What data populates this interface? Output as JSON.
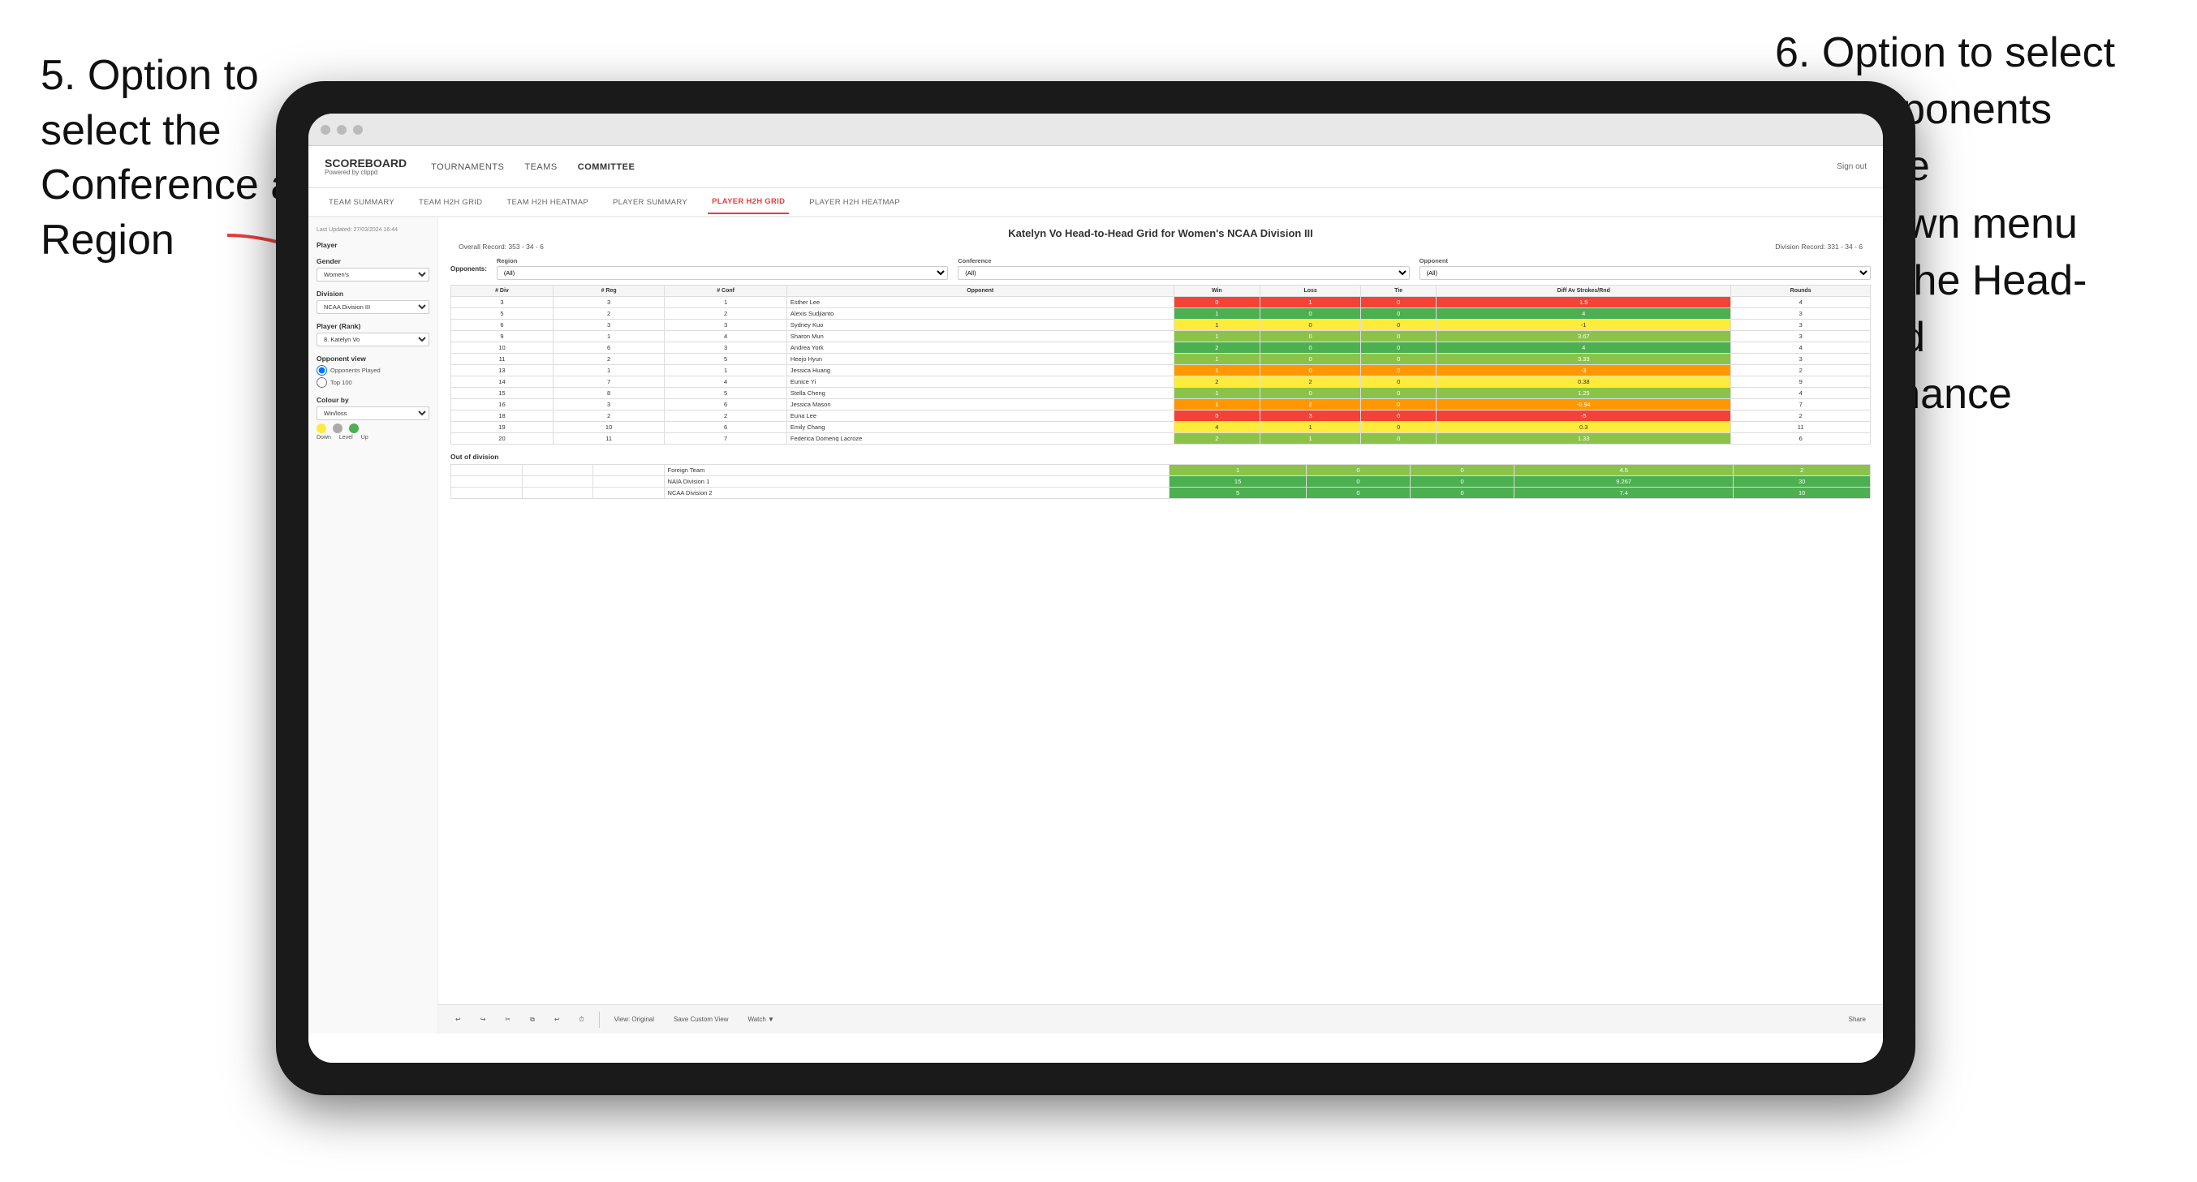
{
  "annotations": {
    "left": {
      "line1": "5. Option to",
      "line2": "select the",
      "line3": "Conference and",
      "line4": "Region"
    },
    "right": {
      "line1": "6. Option to select",
      "line2": "the Opponents",
      "line3": "from the",
      "line4": "dropdown menu",
      "line5": "to see the Head-",
      "line6": "to-Head",
      "line7": "performance"
    }
  },
  "nav": {
    "logo": "SCOREBOARD",
    "logo_sub": "Powered by clippd",
    "items": [
      "TOURNAMENTS",
      "TEAMS",
      "COMMITTEE"
    ],
    "active_item": "COMMITTEE",
    "right": [
      "Sign out"
    ]
  },
  "sub_nav": {
    "items": [
      "TEAM SUMMARY",
      "TEAM H2H GRID",
      "TEAM H2H HEATMAP",
      "PLAYER SUMMARY",
      "PLAYER H2H GRID",
      "PLAYER H2H HEATMAP"
    ],
    "active_item": "PLAYER H2H GRID"
  },
  "sidebar": {
    "updated": "Last Updated: 27/03/2024 16:44",
    "player_label": "Player",
    "gender_label": "Gender",
    "gender_value": "Women's",
    "division_label": "Division",
    "division_value": "NCAA Division III",
    "player_rank_label": "Player (Rank)",
    "player_rank_value": "8. Katelyn Vo",
    "opponent_view_label": "Opponent view",
    "opponent_options": [
      "Opponents Played",
      "Top 100"
    ],
    "opponent_selected": "Opponents Played",
    "colour_by_label": "Colour by",
    "colour_by_value": "Win/loss",
    "legend_labels": [
      "Down",
      "Level",
      "Up"
    ]
  },
  "main": {
    "title": "Katelyn Vo Head-to-Head Grid for Women's NCAA Division III",
    "overall_record": "Overall Record: 353 - 34 - 6",
    "division_record": "Division Record: 331 - 34 - 6",
    "region_label": "Region",
    "conference_label": "Conference",
    "opponent_label": "Opponent",
    "opponents_label": "Opponents:",
    "region_value": "(All)",
    "conference_value": "(All)",
    "opponent_value": "(All)",
    "table_headers": [
      "# Div",
      "# Reg",
      "# Conf",
      "Opponent",
      "Win",
      "Loss",
      "Tie",
      "Diff Av Strokes/Rnd",
      "Rounds"
    ],
    "rows": [
      {
        "div": 3,
        "reg": 3,
        "conf": 1,
        "opponent": "Esther Lee",
        "win": 0,
        "loss": 1,
        "tie": 0,
        "diff": 1.5,
        "rounds": 4,
        "color": "red"
      },
      {
        "div": 5,
        "reg": 2,
        "conf": 2,
        "opponent": "Alexis Sudjianto",
        "win": 1,
        "loss": 0,
        "tie": 0,
        "diff": 4.0,
        "rounds": 3,
        "color": "green-dark"
      },
      {
        "div": 6,
        "reg": 3,
        "conf": 3,
        "opponent": "Sydney Kuo",
        "win": 1,
        "loss": 0,
        "tie": 0,
        "diff": -1.0,
        "rounds": 3,
        "color": "yellow"
      },
      {
        "div": 9,
        "reg": 1,
        "conf": 4,
        "opponent": "Sharon Mun",
        "win": 1,
        "loss": 0,
        "tie": 0,
        "diff": 3.67,
        "rounds": 3,
        "color": "green-light"
      },
      {
        "div": 10,
        "reg": 6,
        "conf": 3,
        "opponent": "Andrea York",
        "win": 2,
        "loss": 0,
        "tie": 0,
        "diff": 4.0,
        "rounds": 4,
        "color": "green-dark"
      },
      {
        "div": 11,
        "reg": 2,
        "conf": 5,
        "opponent": "Heejo Hyun",
        "win": 1,
        "loss": 0,
        "tie": 0,
        "diff": 3.33,
        "rounds": 3,
        "color": "green-light"
      },
      {
        "div": 13,
        "reg": 1,
        "conf": 1,
        "opponent": "Jessica Huang",
        "win": 1,
        "loss": 0,
        "tie": 0,
        "diff": -3.0,
        "rounds": 2,
        "color": "orange"
      },
      {
        "div": 14,
        "reg": 7,
        "conf": 4,
        "opponent": "Eunice Yi",
        "win": 2,
        "loss": 2,
        "tie": 0,
        "diff": 0.38,
        "rounds": 9,
        "color": "yellow"
      },
      {
        "div": 15,
        "reg": 8,
        "conf": 5,
        "opponent": "Stella Cheng",
        "win": 1,
        "loss": 0,
        "tie": 0,
        "diff": 1.25,
        "rounds": 4,
        "color": "green-light"
      },
      {
        "div": 16,
        "reg": 3,
        "conf": 6,
        "opponent": "Jessica Mason",
        "win": 1,
        "loss": 2,
        "tie": 0,
        "diff": -0.94,
        "rounds": 7,
        "color": "orange"
      },
      {
        "div": 18,
        "reg": 2,
        "conf": 2,
        "opponent": "Euna Lee",
        "win": 0,
        "loss": 3,
        "tie": 0,
        "diff": -5.0,
        "rounds": 2,
        "color": "red"
      },
      {
        "div": 19,
        "reg": 10,
        "conf": 6,
        "opponent": "Emily Chang",
        "win": 4,
        "loss": 1,
        "tie": 0,
        "diff": 0.3,
        "rounds": 11,
        "color": "yellow"
      },
      {
        "div": 20,
        "reg": 11,
        "conf": 7,
        "opponent": "Federica Domenq Lacroze",
        "win": 2,
        "loss": 1,
        "tie": 0,
        "diff": 1.33,
        "rounds": 6,
        "color": "green-light"
      }
    ],
    "out_of_division_label": "Out of division",
    "out_rows": [
      {
        "opponent": "Foreign Team",
        "win": 1,
        "loss": 0,
        "tie": 0,
        "diff": 4.5,
        "rounds": 2,
        "color": "green-light"
      },
      {
        "opponent": "NAIA Division 1",
        "win": 15,
        "loss": 0,
        "tie": 0,
        "diff": 9.267,
        "rounds": 30,
        "color": "green-dark"
      },
      {
        "opponent": "NCAA Division 2",
        "win": 5,
        "loss": 0,
        "tie": 0,
        "diff": 7.4,
        "rounds": 10,
        "color": "green-dark"
      }
    ]
  },
  "toolbar": {
    "buttons": [
      "↩",
      "↪",
      "✂",
      "⧉",
      "↩",
      "⏱",
      "View: Original",
      "Save Custom View",
      "Watch ▼",
      "Share"
    ]
  }
}
